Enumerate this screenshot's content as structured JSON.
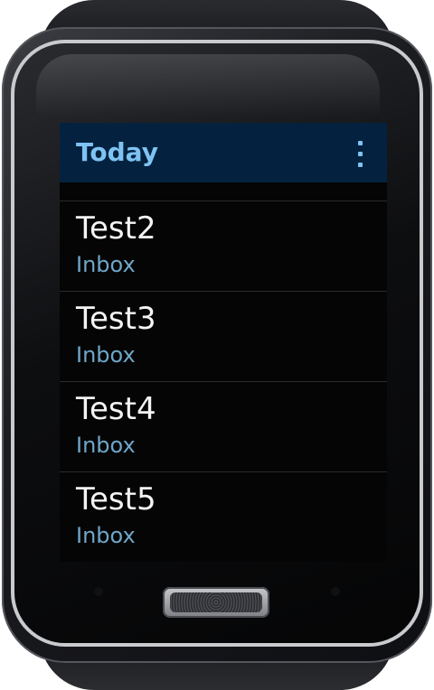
{
  "header": {
    "title": "Today",
    "more_icon": "more-vertical-icon"
  },
  "accent_color": "#7ec3f2",
  "header_bg_color": "#04223f",
  "messages": [
    {
      "title": "Test2",
      "folder": "Inbox"
    },
    {
      "title": "Test3",
      "folder": "Inbox"
    },
    {
      "title": "Test4",
      "folder": "Inbox"
    },
    {
      "title": "Test5",
      "folder": "Inbox"
    }
  ]
}
